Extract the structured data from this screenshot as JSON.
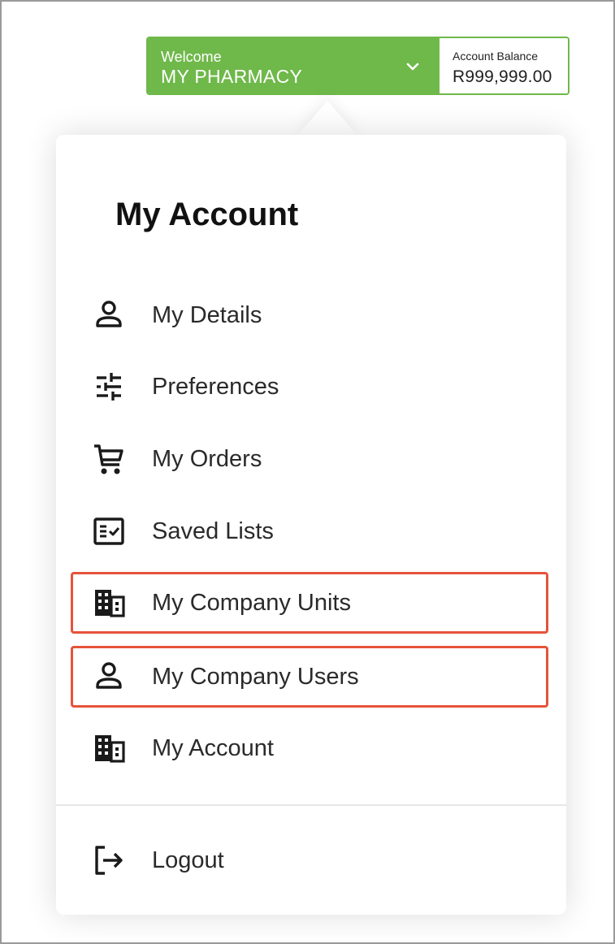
{
  "header": {
    "welcome_label": "Welcome",
    "account_name": "MY PHARMACY",
    "balance_label": "Account Balance",
    "balance_value": "R999,999.00",
    "accent_color": "#6fb84a"
  },
  "menu": {
    "title": "My Account",
    "items": [
      {
        "label": "My Details",
        "icon": "user-icon"
      },
      {
        "label": "Preferences",
        "icon": "sliders-icon"
      },
      {
        "label": "My Orders",
        "icon": "cart-icon"
      },
      {
        "label": "Saved Lists",
        "icon": "checklist-icon"
      },
      {
        "label": "My Company Units",
        "icon": "building-icon",
        "highlighted": true
      },
      {
        "label": "My Company Users",
        "icon": "user-icon",
        "highlighted": true
      },
      {
        "label": "My Account",
        "icon": "building-icon"
      }
    ],
    "logout_label": "Logout",
    "highlight_color": "#e5533a"
  }
}
